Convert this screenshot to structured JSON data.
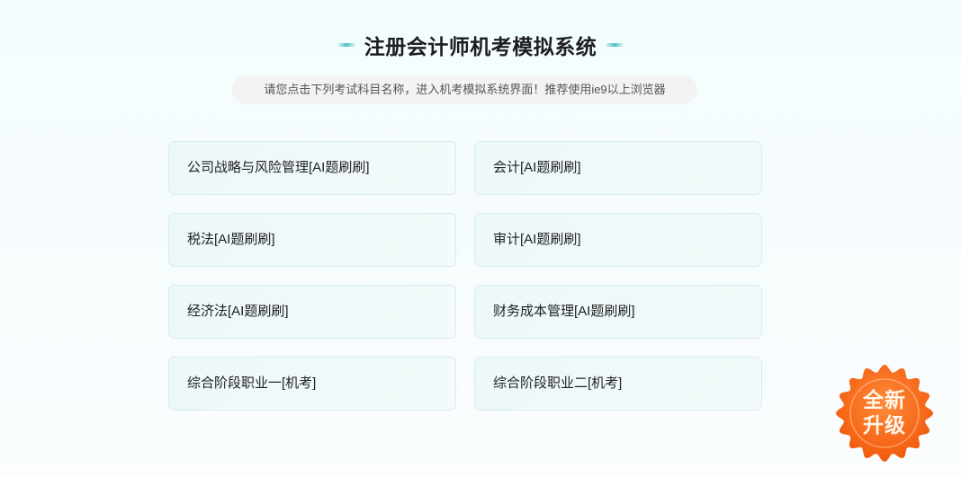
{
  "header": {
    "title": "注册会计师机考模拟系统",
    "subtitle": "请您点击下列考试科目名称，进入机考模拟系统界面！推荐使用ie9以上浏览器"
  },
  "subjects": [
    {
      "label": "公司战略与风险管理[AI题刷刷]"
    },
    {
      "label": "会计[AI题刷刷]"
    },
    {
      "label": "税法[AI题刷刷]"
    },
    {
      "label": "审计[AI题刷刷]"
    },
    {
      "label": "经济法[AI题刷刷]"
    },
    {
      "label": "财务成本管理[AI题刷刷]"
    },
    {
      "label": "综合阶段职业一[机考]"
    },
    {
      "label": "综合阶段职业二[机考]"
    }
  ],
  "badge": {
    "line1": "全新",
    "line2": "升级",
    "color": "#f76a12"
  }
}
